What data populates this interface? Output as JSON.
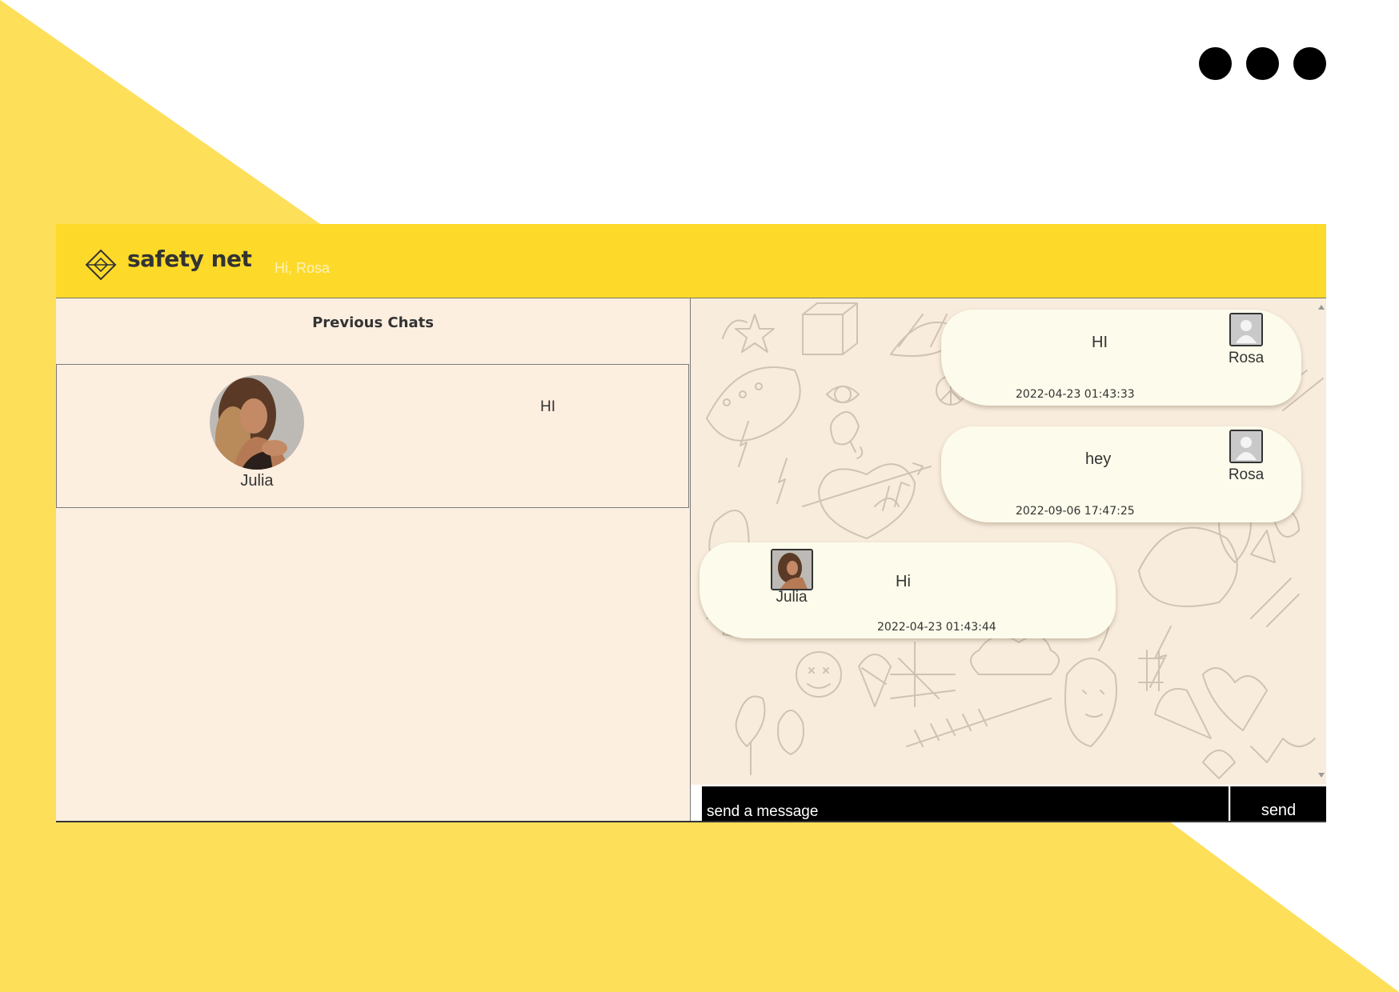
{
  "colors": {
    "background_accent": "#fedf59",
    "header": "#fdda2a",
    "panel": "#fdefe0",
    "bubble": "#fdfbeb",
    "composer": "#000000"
  },
  "window_controls": {
    "icon": "more-dots-icon"
  },
  "header": {
    "brand": "safety net",
    "greeting": "Hi, Rosa",
    "logo_icon": "diamond-logo-icon"
  },
  "sidebar": {
    "title": "Previous Chats",
    "chats": [
      {
        "name": "Julia",
        "preview": "HI",
        "avatar_icon": "julia-avatar"
      }
    ]
  },
  "messages": [
    {
      "sender": "Rosa",
      "text": "HI",
      "time": "2022-04-23 01:43:33",
      "avatar_icon": "user-placeholder-icon"
    },
    {
      "sender": "Rosa",
      "text": "hey",
      "time": "2022-09-06 17:47:25",
      "avatar_icon": "user-placeholder-icon"
    },
    {
      "sender": "Julia",
      "text": "Hi",
      "time": "2022-04-23 01:43:44",
      "avatar_icon": "julia-avatar"
    }
  ],
  "composer": {
    "placeholder": "send a message",
    "send_label": "send"
  }
}
